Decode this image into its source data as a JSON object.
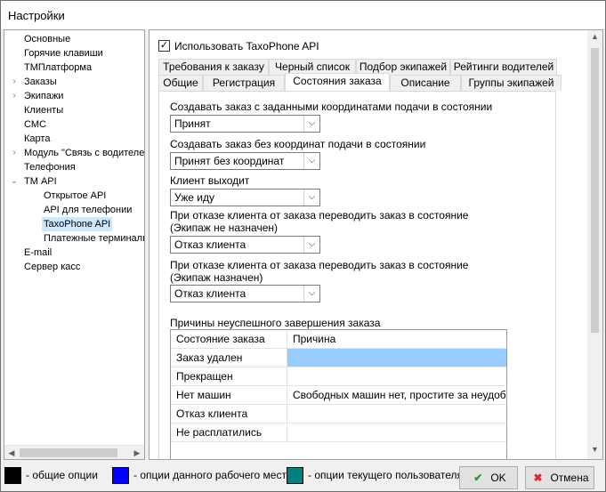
{
  "window": {
    "title": "Настройки"
  },
  "tree": {
    "items": [
      {
        "label": "Основные",
        "expandable": false,
        "selected": false
      },
      {
        "label": "Горячие клавиши",
        "expandable": false,
        "selected": false
      },
      {
        "label": "ТМПлатформа",
        "expandable": false,
        "selected": false
      },
      {
        "label": "Заказы",
        "expandable": true,
        "selected": false
      },
      {
        "label": "Экипажи",
        "expandable": true,
        "selected": false
      },
      {
        "label": "Клиенты",
        "expandable": false,
        "selected": false
      },
      {
        "label": "СМС",
        "expandable": false,
        "selected": false
      },
      {
        "label": "Карта",
        "expandable": false,
        "selected": false
      },
      {
        "label": "Модуль \"Связь с водителем\"",
        "expandable": true,
        "selected": false
      },
      {
        "label": "Телефония",
        "expandable": false,
        "selected": false
      },
      {
        "label": "ТМ API",
        "expandable": true,
        "expanded": true,
        "selected": false
      },
      {
        "label": "Открытое API",
        "child": true,
        "selected": false
      },
      {
        "label": "API для телефонии",
        "child": true,
        "selected": false
      },
      {
        "label": "TaxoPhone API",
        "child": true,
        "selected": true
      },
      {
        "label": "Платежные терминалы",
        "child": true,
        "selected": false
      },
      {
        "label": "E-mail",
        "expandable": false,
        "selected": false
      },
      {
        "label": "Сервер касс",
        "expandable": false,
        "selected": false
      }
    ]
  },
  "panel": {
    "use_api_checkbox": {
      "label": "Использовать TaxoPhone API",
      "checked": true
    },
    "tabs_row1": [
      "Требования к заказу",
      "Черный список",
      "Подбор экипажей",
      "Рейтинги водителей"
    ],
    "tabs_row2": [
      "Общие",
      "Регистрация",
      "Состояния заказа",
      "Описание",
      "Группы экипажей"
    ],
    "active_tab": "Состояния заказа",
    "fields": [
      {
        "label": "Создавать заказ с заданными координатами подачи в состоянии",
        "value": "Принят"
      },
      {
        "label": "Создавать заказ без координат подачи в состоянии",
        "value": "Принят без координат"
      },
      {
        "label": "Клиент выходит",
        "value": "Уже иду"
      },
      {
        "label": "При отказе клиента от заказа переводить заказ в состояние\n(Экипаж не назначен)",
        "value": "Отказ клиента"
      },
      {
        "label": "При отказе клиента от заказа переводить заказ в состояние\n(Экипаж назначен)",
        "value": "Отказ клиента"
      }
    ],
    "reasons": {
      "title": "Причины неуспешного завершения заказа",
      "columns": [
        "Состояние заказа",
        "Причина"
      ],
      "rows": [
        [
          "Заказ удален",
          ""
        ],
        [
          "Прекращен",
          ""
        ],
        [
          "Нет машин",
          "Свободных машин нет, простите за неудобства"
        ],
        [
          "Отказ клиента",
          ""
        ],
        [
          "Не расплатились",
          ""
        ]
      ]
    }
  },
  "legend": [
    {
      "color": "#000000",
      "text": "- общие опции"
    },
    {
      "color": "#0000ff",
      "text": "- опции данного рабочего места"
    },
    {
      "color": "#008080",
      "text": "- опции текущего пользователя"
    }
  ],
  "buttons": {
    "ok": "OK",
    "cancel": "Отмена"
  }
}
